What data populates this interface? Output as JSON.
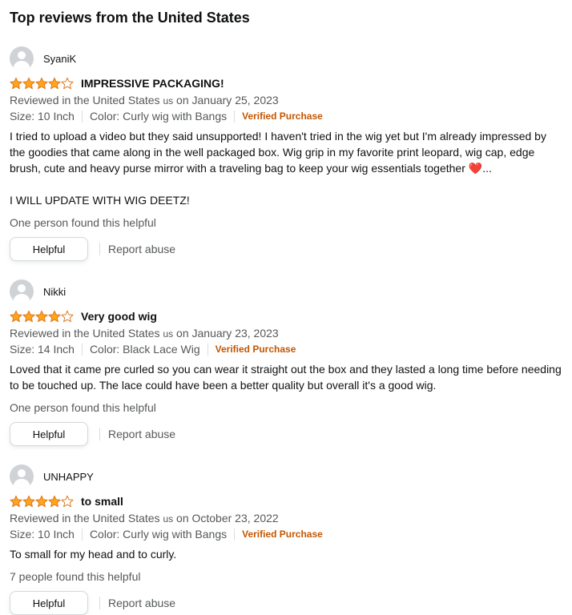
{
  "section": {
    "title": "Top reviews from the United States"
  },
  "colors": {
    "star_fill": "#ffa41c",
    "star_outline": "#de7921",
    "verified": "#c45500",
    "meta": "#565959"
  },
  "reviews": [
    {
      "profile_name": "SyaniK",
      "rating": 4,
      "title": "IMPRESSIVE PACKAGING!",
      "date_prefix": "Reviewed in the United States",
      "date_country": "us",
      "date": "on January 25, 2023",
      "size": "Size: 10 Inch",
      "color": "Color: Curly wig with Bangs",
      "verified": "Verified Purchase",
      "body": [
        "I tried to upload a video but they said unsupported! I haven't tried in the wig yet but I'm already impressed by the goodies that came along in the well packaged box. Wig grip in my favorite print leopard, wig cap, edge brush, cute and heavy purse mirror    with a traveling bag to keep your wig essentials together",
        "I WILL UPDATE WITH WIG DEETZ!"
      ],
      "body_heart": "❤️",
      "body_ellipsis": "...",
      "helpful_count": "One person found this helpful",
      "helpful_label": "Helpful",
      "report_label": "Report abuse"
    },
    {
      "profile_name": "Nikki",
      "rating": 4,
      "title": "Very good wig",
      "date_prefix": "Reviewed in the United States",
      "date_country": "us",
      "date": "on January 23, 2023",
      "size": "Size: 14 Inch",
      "color": "Color: Black Lace Wig",
      "verified": "Verified Purchase",
      "body": [
        "Loved that it came pre curled so you can wear it straight out the box and they lasted a long time before needing to be touched up. The lace could have been a better quality but overall it's a good wig."
      ],
      "helpful_count": "One person found this helpful",
      "helpful_label": "Helpful",
      "report_label": "Report abuse"
    },
    {
      "profile_name": "UNHAPPY",
      "rating": 4,
      "title": "to small",
      "date_prefix": "Reviewed in the United States",
      "date_country": "us",
      "date": "on October 23, 2022",
      "size": "Size: 10 Inch",
      "color": "Color: Curly wig with Bangs",
      "verified": "Verified Purchase",
      "body": [
        "To small for my head and to curly."
      ],
      "helpful_count": "7 people found this helpful",
      "helpful_label": "Helpful",
      "report_label": "Report abuse"
    }
  ]
}
